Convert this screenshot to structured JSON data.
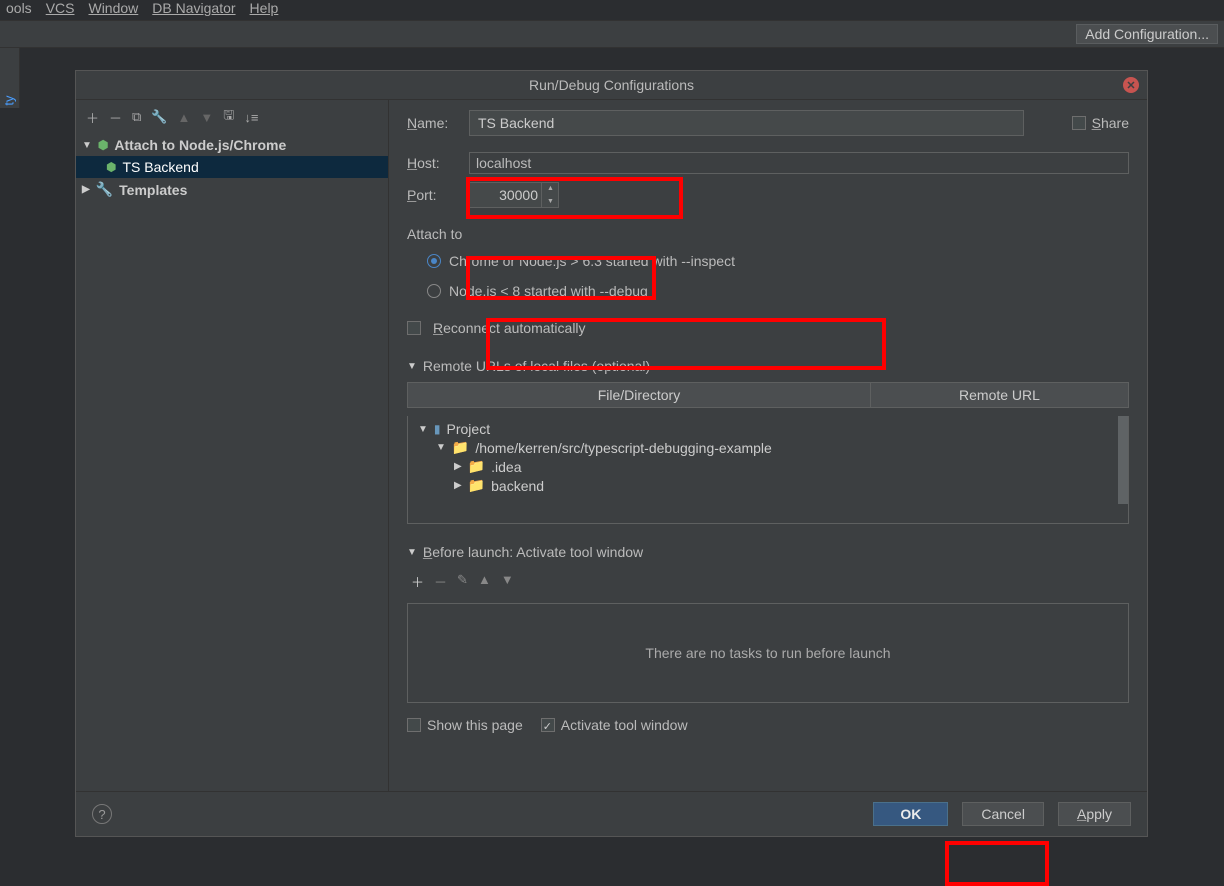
{
  "menubar": [
    "ools",
    "VCS",
    "Window",
    "DB Navigator",
    "Help"
  ],
  "topbar": {
    "add_conf": "Add Configuration..."
  },
  "left_strip": "ty",
  "dialog": {
    "title": "Run/Debug Configurations",
    "left": {
      "config_type": "Attach to Node.js/Chrome",
      "config_item": "TS Backend",
      "templates": "Templates"
    },
    "share_label": "Share",
    "name_label": "Name:",
    "name_value": "TS Backend",
    "host_label": "Host:",
    "host_value": "localhost",
    "port_label": "Port:",
    "port_value": "30000",
    "attach_label": "Attach to",
    "radio1": "Chrome or Node.js > 6.3 started with --inspect",
    "radio2": "Node.js < 8 started with --debug",
    "reconnect_label": "Reconnect automatically",
    "remote_urls_label": "Remote URLs of local files (optional)",
    "table": {
      "col1": "File/Directory",
      "col2": "Remote URL"
    },
    "file_tree": {
      "project": "Project",
      "root": "/home/kerren/src/typescript-debugging-example",
      "items": [
        ".idea",
        "backend"
      ]
    },
    "before_launch_label": "Before launch: Activate tool window",
    "no_tasks": "There are no tasks to run before launch",
    "show_page": "Show this page",
    "activate_tool": "Activate tool window",
    "buttons": {
      "ok": "OK",
      "cancel": "Cancel",
      "apply": "Apply"
    }
  }
}
